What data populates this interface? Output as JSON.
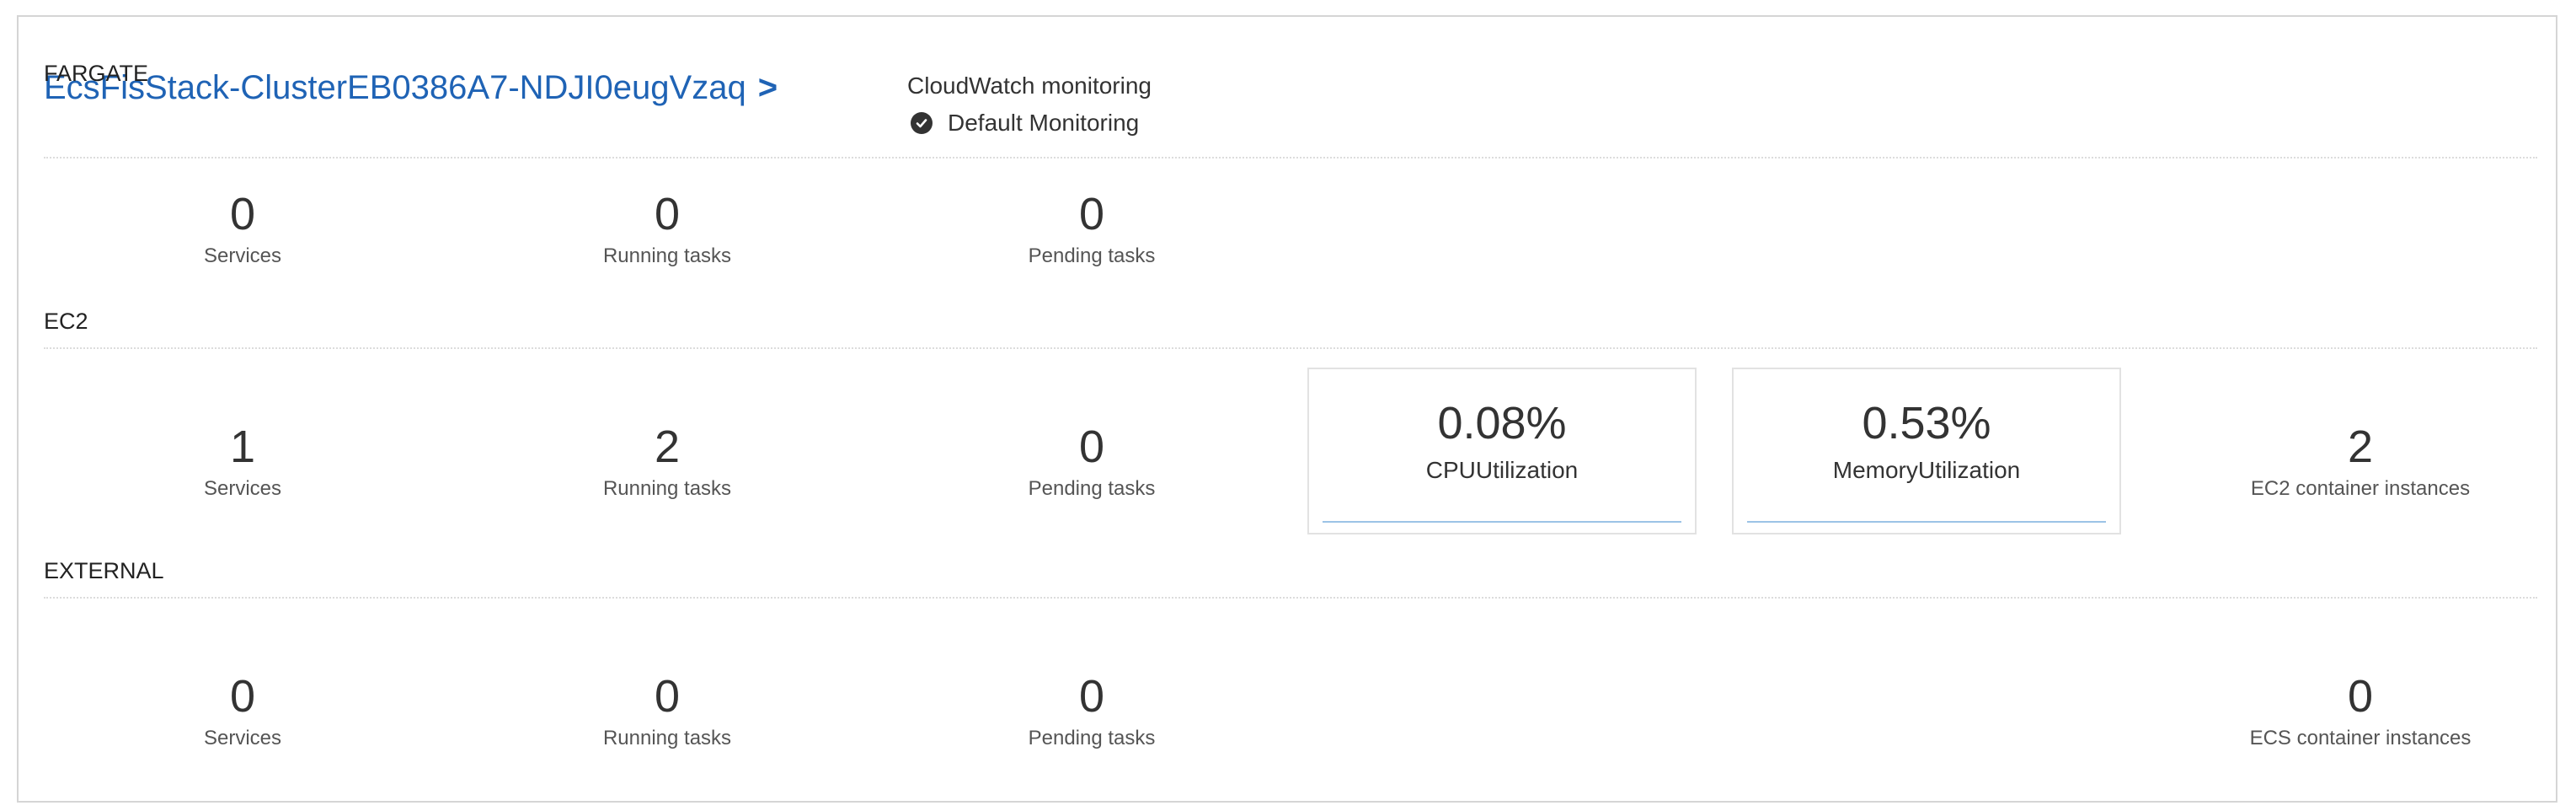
{
  "header": {
    "cluster_name": "EcsFisStack-ClusterEB0386A7-NDJI0eugVzaq",
    "chevron": ">",
    "cloudwatch_title": "CloudWatch monitoring",
    "cloudwatch_status": "Default Monitoring"
  },
  "sections": {
    "fargate": {
      "label": "FARGATE",
      "services": {
        "value": "0",
        "label": "Services"
      },
      "running_tasks": {
        "value": "0",
        "label": "Running tasks"
      },
      "pending_tasks": {
        "value": "0",
        "label": "Pending tasks"
      }
    },
    "ec2": {
      "label": "EC2",
      "services": {
        "value": "1",
        "label": "Services"
      },
      "running_tasks": {
        "value": "2",
        "label": "Running tasks"
      },
      "pending_tasks": {
        "value": "0",
        "label": "Pending tasks"
      },
      "cpu": {
        "value": "0.08%",
        "label": "CPUUtilization"
      },
      "memory": {
        "value": "0.53%",
        "label": "MemoryUtilization"
      },
      "container_instances": {
        "value": "2",
        "label": "EC2 container instances"
      }
    },
    "external": {
      "label": "EXTERNAL",
      "services": {
        "value": "0",
        "label": "Services"
      },
      "running_tasks": {
        "value": "0",
        "label": "Running tasks"
      },
      "pending_tasks": {
        "value": "0",
        "label": "Pending tasks"
      },
      "container_instances": {
        "value": "0",
        "label": "ECS container instances"
      }
    }
  },
  "icons": {
    "status": "check-circle-icon"
  },
  "colors": {
    "link": "#1f63b5",
    "sparkline": "#9cc3e6",
    "text": "#333333"
  }
}
